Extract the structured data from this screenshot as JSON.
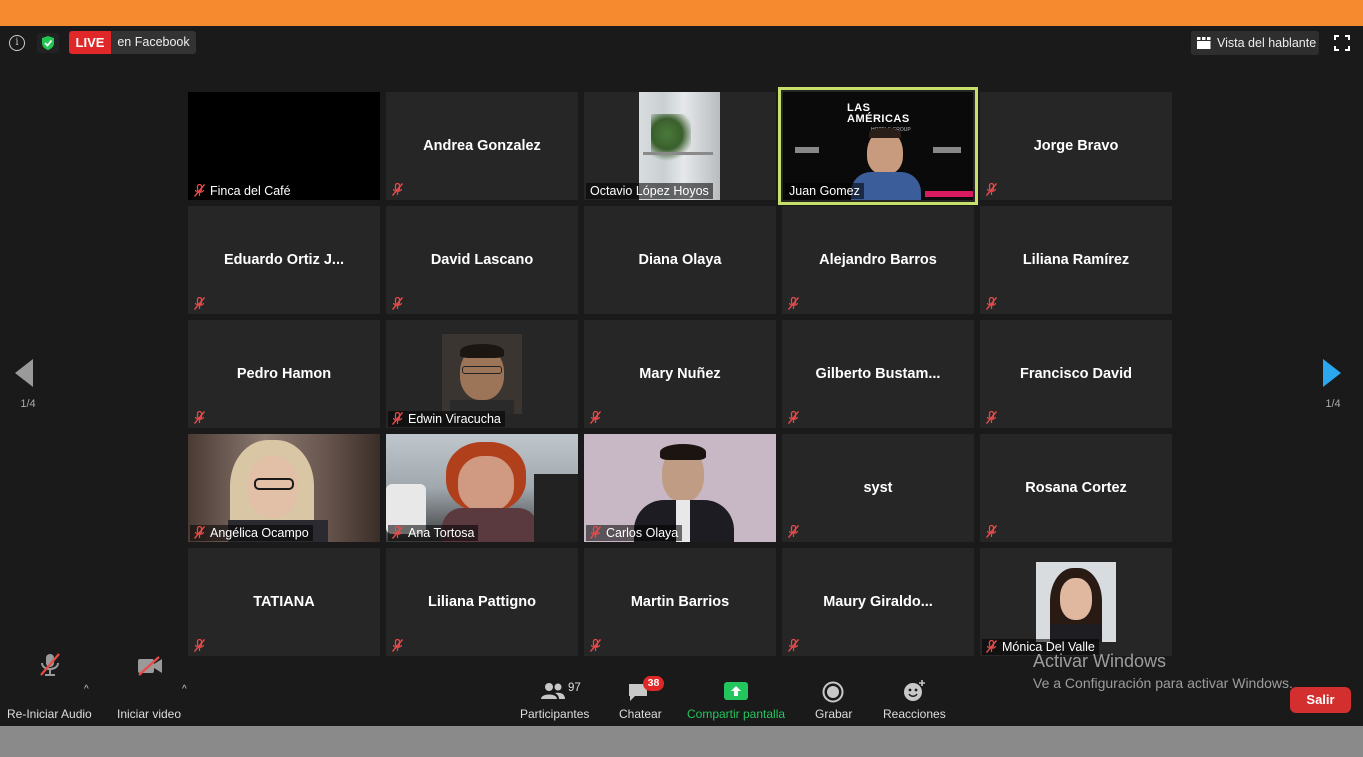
{
  "header": {
    "live_label": "LIVE",
    "live_target": "en Facebook",
    "view_label": "Vista del hablante"
  },
  "pager": {
    "left": "1/4",
    "right": "1/4"
  },
  "tiles": [
    {
      "name": "Finca del Café",
      "video": true
    },
    {
      "name": "Andrea Gonzalez",
      "video": false
    },
    {
      "name": "Octavio López Hoyos",
      "video": true
    },
    {
      "name": "Juan Gomez",
      "video": true,
      "active": true
    },
    {
      "name": "Jorge Bravo",
      "video": false
    },
    {
      "name": "Eduardo  Ortiz  J...",
      "video": false
    },
    {
      "name": "David  Lascano",
      "video": false
    },
    {
      "name": "Diana Olaya",
      "video": false
    },
    {
      "name": "Alejandro Barros",
      "video": false
    },
    {
      "name": "Liliana Ramírez",
      "video": false
    },
    {
      "name": "Pedro Hamon",
      "video": false
    },
    {
      "name": "Edwin Viracucha",
      "video": true
    },
    {
      "name": "Mary Nuñez",
      "video": false
    },
    {
      "name": "Gilberto  Bustam...",
      "video": false
    },
    {
      "name": "Francisco David",
      "video": false
    },
    {
      "name": "Angélica Ocampo",
      "video": true
    },
    {
      "name": "Ana Tortosa",
      "video": true
    },
    {
      "name": "Carlos Olaya",
      "video": true
    },
    {
      "name": "syst",
      "video": false
    },
    {
      "name": "Rosana Cortez",
      "video": false
    },
    {
      "name": "TATIANA",
      "video": false
    },
    {
      "name": "Liliana Pattigno",
      "video": false
    },
    {
      "name": "Martin Barrios",
      "video": false
    },
    {
      "name": "Maury  Giraldo...",
      "video": false
    },
    {
      "name": "Mónica Del Valle",
      "video": true
    }
  ],
  "slide": {
    "line1": "LAS",
    "line2": "AMÉRICAS",
    "line3": "HOTELS GROUP"
  },
  "toolbar": {
    "audio_label": "Re-Iniciar Audio",
    "video_label": "Iniciar video",
    "participants_label": "Participantes",
    "participants_count": "97",
    "chat_label": "Chatear",
    "chat_badge": "38",
    "share_label": "Compartir pantalla",
    "record_label": "Grabar",
    "reactions_label": "Reacciones",
    "leave_label": "Salir"
  },
  "watermark": {
    "line1": "Activar Windows",
    "line2": "Ve a Configuración para activar Windows."
  },
  "colors": {
    "top_bar": "#f68a2e",
    "live_red": "#e02828",
    "share_green": "#22c55e",
    "active_speaker": "#c7e06a",
    "nav_arrow": "#2aa7ef"
  }
}
